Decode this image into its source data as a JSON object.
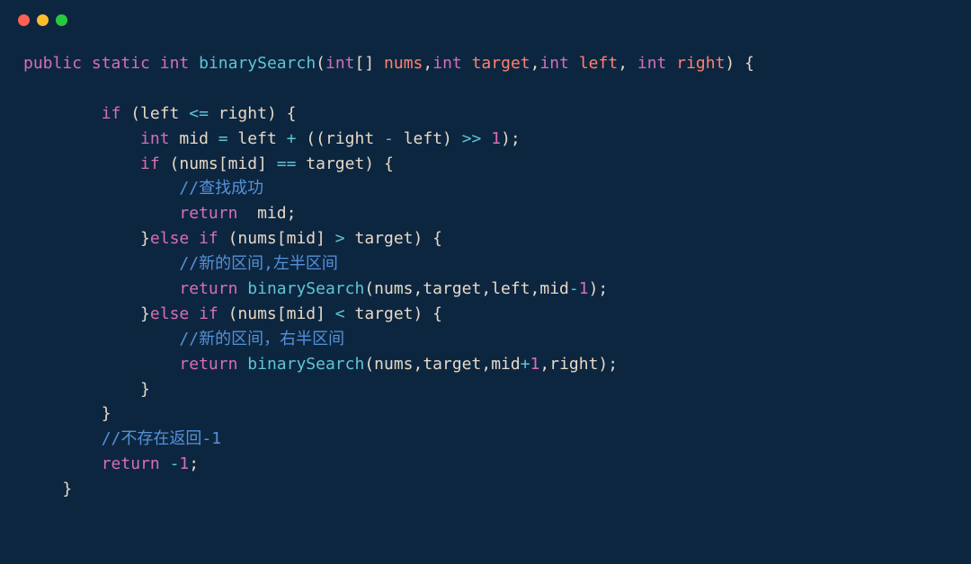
{
  "window_controls": {
    "close": "close",
    "minimize": "minimize",
    "maximize": "maximize"
  },
  "code": {
    "line1_kw_public": "public",
    "line1_kw_static": "static",
    "line1_type_int": "int",
    "line1_fn": "binarySearch",
    "line1_type_int2": "int",
    "line1_brackets": "[] ",
    "line1_param_nums": "nums",
    "line1_comma1": ",",
    "line1_type_int3": "int",
    "line1_param_target": "target",
    "line1_comma2": ",",
    "line1_type_int4": "int",
    "line1_param_left": "left",
    "line1_comma3": ", ",
    "line1_type_int5": "int",
    "line1_param_right": "right",
    "line1_paren_close": ") {",
    "line2_blank": "",
    "line3_if": "        if",
    "line3_cond": " (left ",
    "line3_op_le": "<=",
    "line3_cond2": " right) {",
    "line4_int": "            int",
    "line4_text": " mid ",
    "line4_op_eq": "=",
    "line4_text2": " left ",
    "line4_op_plus": "+",
    "line4_text3": " ((right ",
    "line4_op_minus": "-",
    "line4_text4": " left) ",
    "line4_op_shr": ">>",
    "line4_space": " ",
    "line4_num1": "1",
    "line4_end": ");",
    "line5_if": "            if",
    "line5_cond": " (nums[mid] ",
    "line5_op_eqeq": "==",
    "line5_cond2": " target) {",
    "line6_comment": "                //查找成功",
    "line7_return": "                return",
    "line7_text": "  mid;",
    "line8_else": "            }",
    "line8_else_kw": "else if",
    "line8_cond": " (nums[mid] ",
    "line8_op_gt": ">",
    "line8_cond2": " target) {",
    "line9_comment": "                //新的区间,左半区间",
    "line10_return": "                return",
    "line10_space": " ",
    "line10_fn": "binarySearch",
    "line10_args": "(nums,target,left,mid",
    "line10_op_minus": "-",
    "line10_num": "1",
    "line10_end": ");",
    "line11_else": "            }",
    "line11_else_kw": "else if",
    "line11_cond": " (nums[mid] ",
    "line11_op_lt": "<",
    "line11_cond2": " target) {",
    "line12_comment": "                //新的区间，右半区间",
    "line13_return": "                return",
    "line13_space": " ",
    "line13_fn": "binarySearch",
    "line13_args": "(nums,target,mid",
    "line13_op_plus": "+",
    "line13_num": "1",
    "line13_args2": ",right);",
    "line14_close": "            }",
    "line15_close": "        }",
    "line16_comment": "        //不存在返回-1",
    "line17_return": "        return",
    "line17_space": " ",
    "line17_op_minus": "-",
    "line17_num": "1",
    "line17_end": ";",
    "line18_close": "    }"
  }
}
